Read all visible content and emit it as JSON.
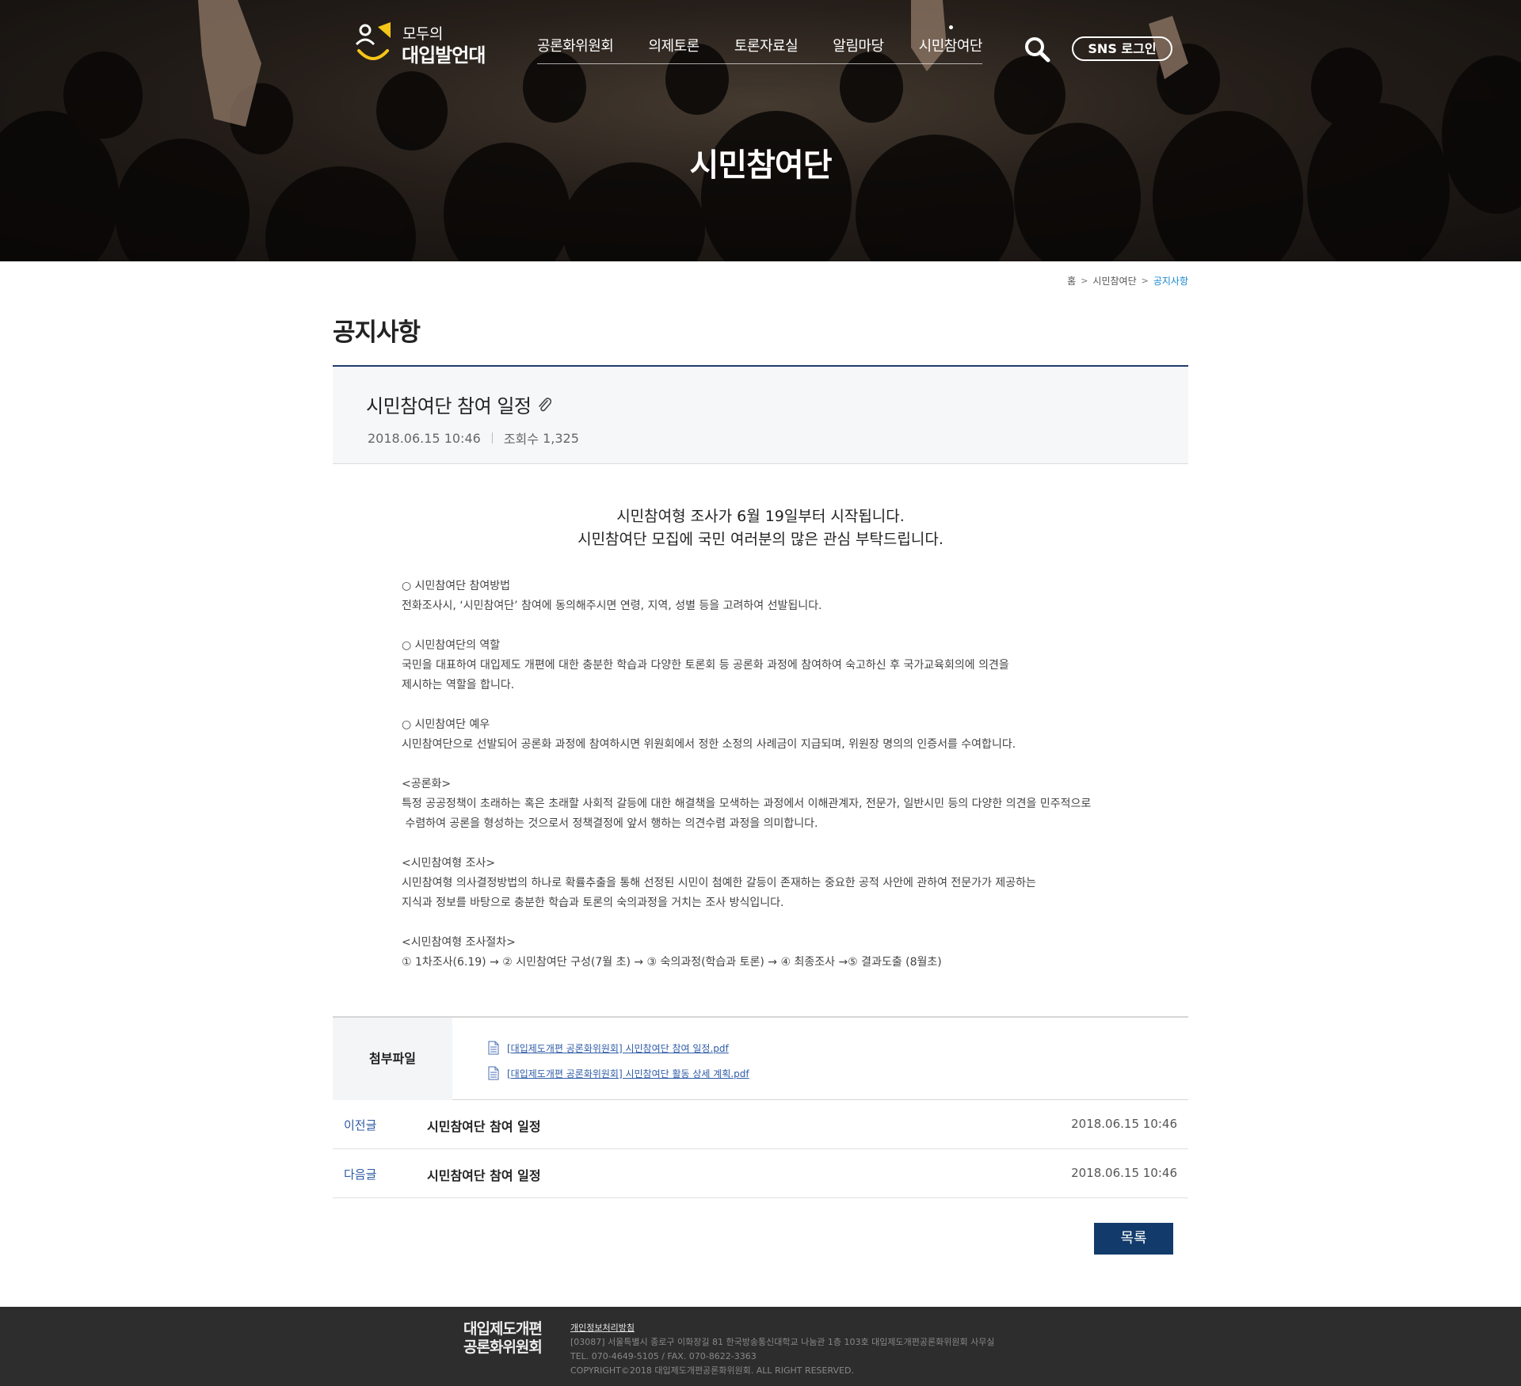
{
  "header": {
    "logo_line1": "모두의",
    "logo_line2": "대입발언대",
    "nav": [
      {
        "label": "공론화위원회"
      },
      {
        "label": "의제토론"
      },
      {
        "label": "토론자료실"
      },
      {
        "label": "알림마당"
      },
      {
        "label": "시민참여단"
      }
    ],
    "active_nav": "시민참여단",
    "search_icon": "search-icon",
    "sns_login_label": "SNS 로그인"
  },
  "hero": {
    "title": "시민참여단"
  },
  "breadcrumb": {
    "home": "홈",
    "section": "시민참여단",
    "current": "공지사항",
    "current_color": "#1a8ad0"
  },
  "page": {
    "title": "공지사항"
  },
  "post": {
    "title": "시민참여단 참여 일정",
    "attachment_icon": "paperclip-icon",
    "date": "2018.06.15  10:46",
    "views_label": "조회수",
    "views": "1,325",
    "lead_line1": "시민참여형 조사가 6월 19일부터 시작됩니다.",
    "lead_line2": "시민참여단 모집에 국민 여러분의 많은 관심 부탁드립니다.",
    "paragraphs": [
      [
        "○ 시민참여단 참여방법",
        "전화조사시, ‘시민참여단’ 참여에 동의해주시면 연령, 지역, 성별 등을 고려하여 선발됩니다."
      ],
      [
        "○ 시민참여단의 역할",
        "국민을 대표하여 대입제도 개편에 대한 충분한 학습과 다양한 토론회 등 공론화 과정에 참여하여 숙고하신 후 국가교육회의에 의견을",
        "제시하는 역할을 합니다."
      ],
      [
        "○ 시민참여단 예우",
        "시민참여단으로 선발되어 공론화 과정에 참여하시면 위원회에서 정한 소정의 사례금이 지급되며, 위원장 명의의 인증서를 수여합니다."
      ],
      [
        "<공론화>",
        "특정 공공정책이 초래하는 혹은 초래할 사회적 갈등에 대한 해결책을 모색하는 과정에서 이해관계자, 전문가, 일반시민 등의 다양한 의견을 민주적으로",
        " 수렴하여 공론을 형성하는 것으로서 정책결정에 앞서 행하는 의견수렴 과정을 의미합니다."
      ],
      [
        "<시민참여형 조사>",
        "시민참여형 의사결정방법의 하나로 확률추출을 통해 선정된 시민이 첨예한 갈등이 존재하는 중요한 공적 사안에 관하여 전문가가 제공하는",
        "지식과 정보를 바탕으로 충분한 학습과 토론의 숙의과정을 거치는 조사 방식입니다."
      ],
      [
        "<시민참여형 조사절차>",
        "① 1차조사(6.19) → ② 시민참여단 구성(7월 초) → ③ 숙의과정(학습과 토론) → ④ 최종조사 →⑤ 결과도출 (8월초)"
      ]
    ]
  },
  "attachments": {
    "label": "첨부파일",
    "file_icon": "document-icon",
    "files": [
      "[대입제도개편 공론화위원회] 시민참여단 참여 일정.pdf",
      "[대입제도개편 공론화위원회] 시민참여단 활동 상세 계획.pdf"
    ]
  },
  "prev_post": {
    "label": "이전글",
    "title": "시민참여단 참여 일정",
    "date": "2018.06.15  10:46"
  },
  "next_post": {
    "label": "다음글",
    "title": "시민참여단 참여 일정",
    "date": "2018.06.15  10:46"
  },
  "list_button_label": "목록",
  "footer": {
    "logo_line1": "대입제도개편",
    "logo_line2": "공론화위원회",
    "policy": "개인정보처리방침",
    "address": "[03087] 서울특별시 종로구 이화장길 81 한국방송통신대학교 나눔관 1층 103호 대입제도개편공론화위원회 사무실",
    "tel": "TEL. 070-4649-5105 / FAX. 070-8622-3363",
    "copyright": "COPYRIGHT©2018 대입제도개편공론화위원회. ALL RIGHT RESERVED."
  },
  "colors": {
    "primary_navy": "#123b6b",
    "head_border": "#1f3a6b",
    "link": "#2f5ca8",
    "footer_bg": "#2d2d2d"
  }
}
